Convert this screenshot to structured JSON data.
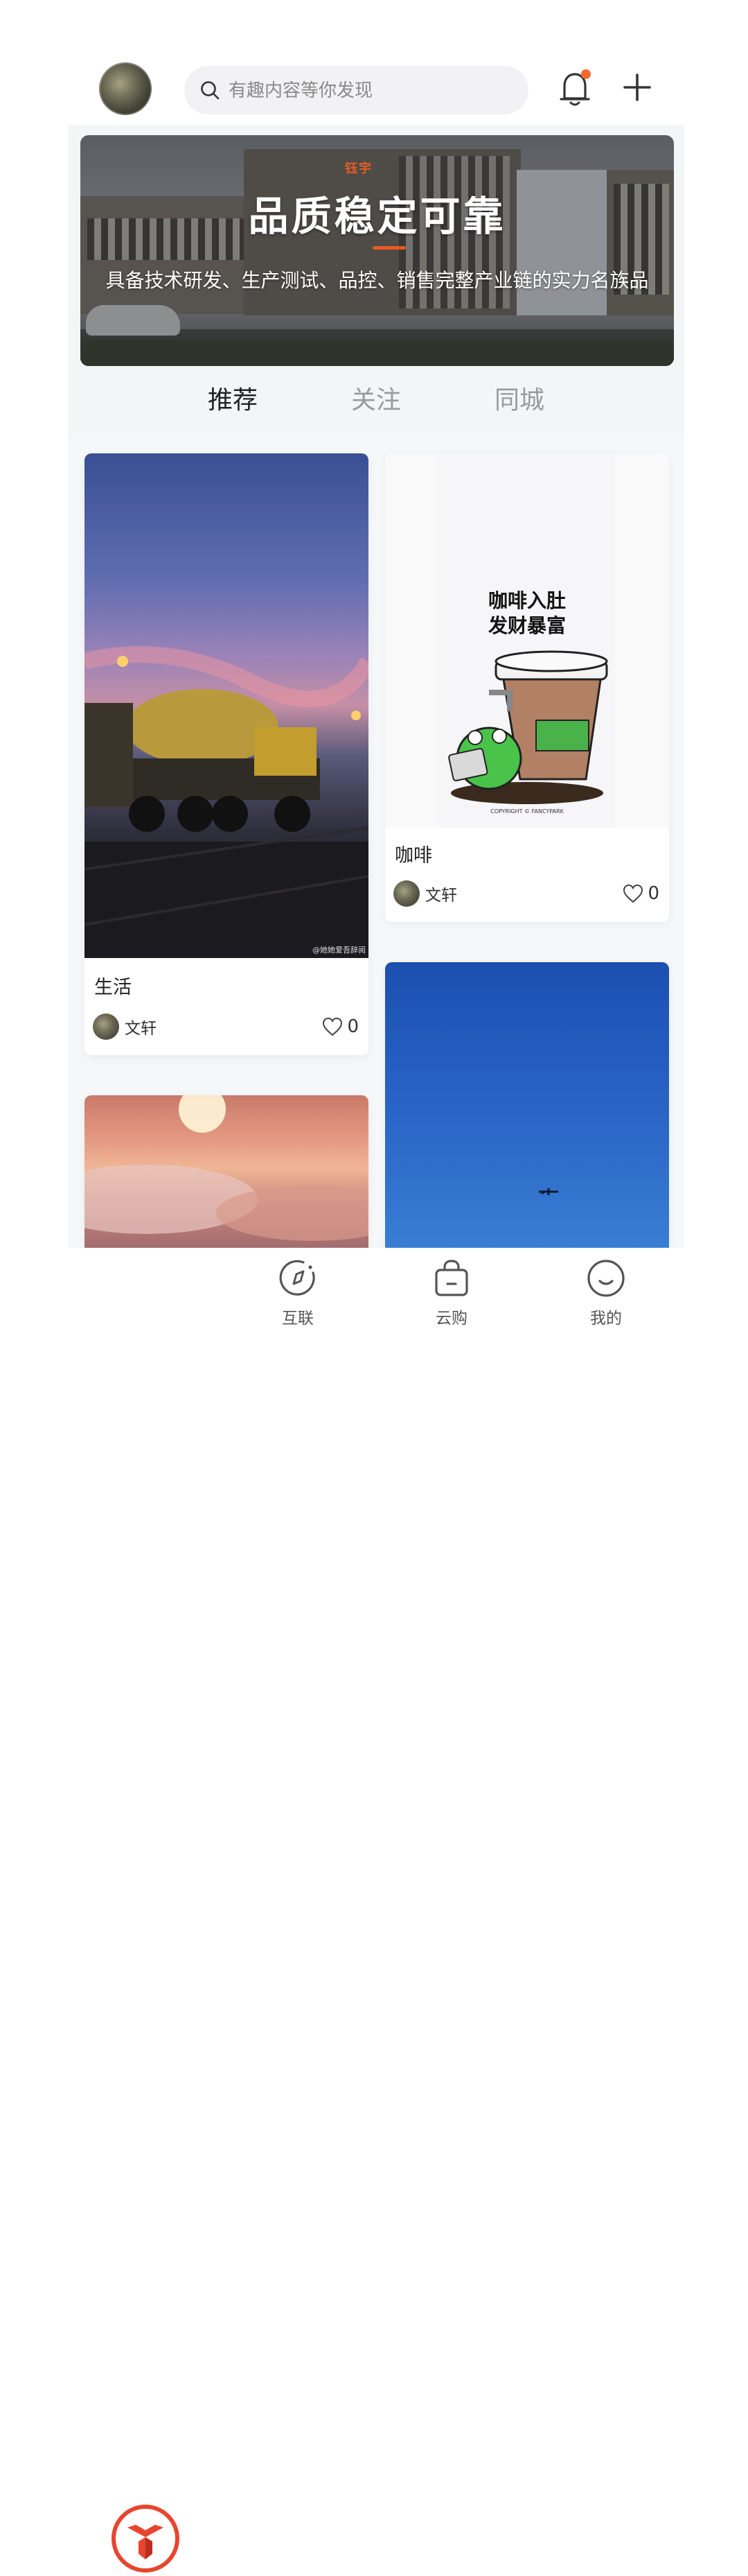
{
  "header": {
    "search_placeholder": "有趣内容等你发现"
  },
  "banner": {
    "logo_text": "钰宇",
    "title": "品质稳定可靠",
    "subtitle": "具备技术研发、生产测试、品控、销售完整产业链的实力名族品"
  },
  "tabs": [
    {
      "label": "推荐",
      "active": true
    },
    {
      "label": "关注",
      "active": false
    },
    {
      "label": "同城",
      "active": false
    }
  ],
  "cards": [
    {
      "title": "生活",
      "author": "文轩",
      "likes": "0",
      "image": "concrete mixer truck at dusk",
      "watermark": "@她她爱吾辞阅"
    },
    {
      "title": "咖啡",
      "author": "文轩",
      "likes": "0",
      "image": "coffee cup with green frog illustration",
      "image_text": "咖啡入肚\n发财暴富",
      "copyright": "COPYRIGHT © FANCYPARK"
    },
    {
      "image": "sunset over clouds"
    },
    {
      "image": "blue sky with airplane"
    }
  ],
  "bottom_nav": [
    {
      "label": "",
      "icon": "home-logo-icon",
      "active": true
    },
    {
      "label": "互联",
      "icon": "compass-icon"
    },
    {
      "label": "云购",
      "icon": "shopping-bag-icon"
    },
    {
      "label": "我的",
      "icon": "smile-profile-icon"
    }
  ],
  "colors": {
    "accent": "#e85b22",
    "notification_dot": "#f26a2c",
    "active_tab": "#222222",
    "inactive_tab": "#9a9a9a"
  }
}
